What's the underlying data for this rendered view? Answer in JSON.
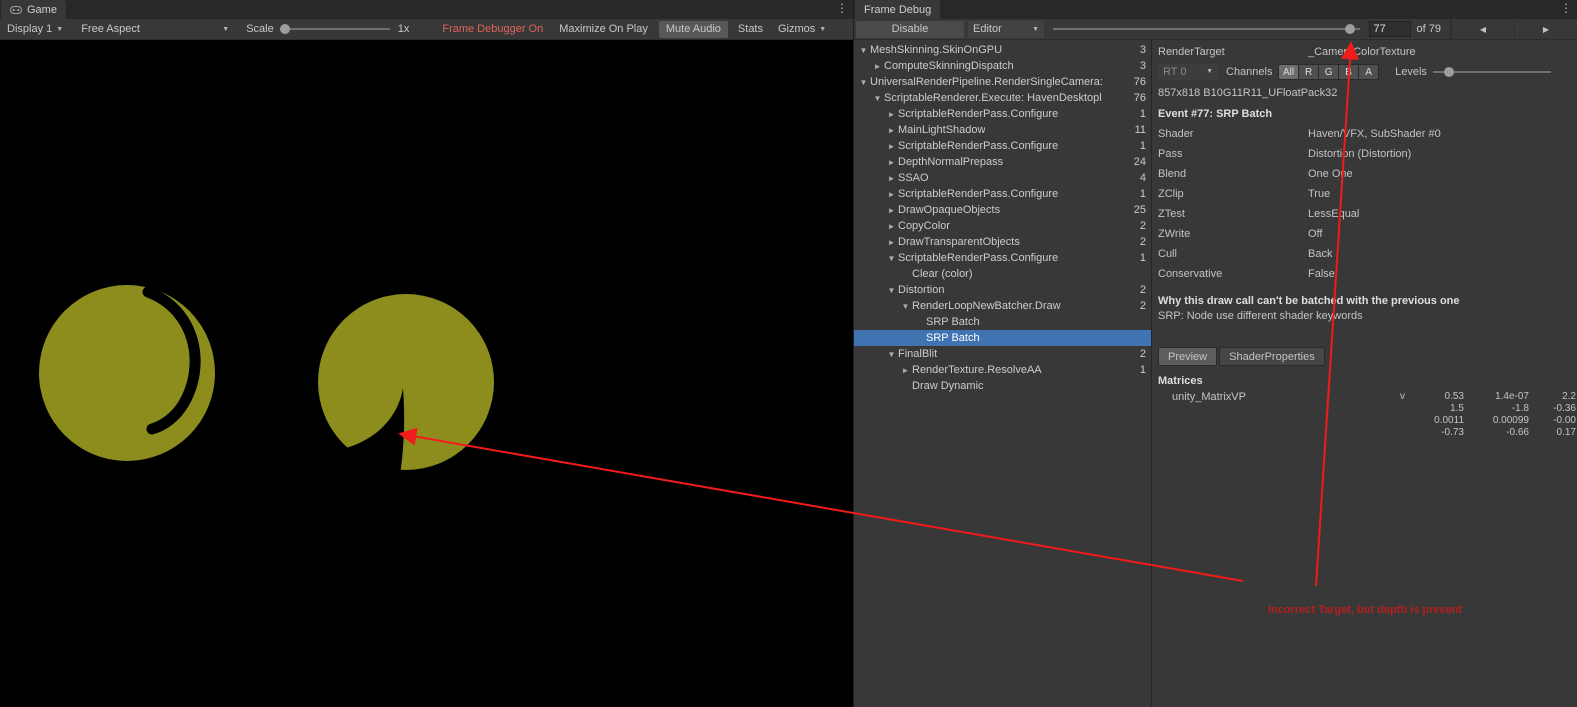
{
  "accent": {
    "selection": "#3f73b1",
    "warning_text": "#e0645a",
    "annotation_red": "#b61f1f",
    "arrow_red": "#f21b1b",
    "blob": "#8d8d1e",
    "game_background": "#000000"
  },
  "icons": {
    "caret": "▼",
    "kebab": "⋮",
    "prev": "◀",
    "next": "▶",
    "foldout_open": "▼",
    "foldout_closed": "►"
  },
  "game_panel": {
    "tab": "Game",
    "toolbar": {
      "display": "Display 1",
      "aspect": "Free Aspect",
      "scale_label": "Scale",
      "scale_value": "1x",
      "frame_debugger": "Frame Debugger On",
      "maximize": "Maximize On Play",
      "mute_audio": "Mute Audio",
      "stats": "Stats",
      "gizmos": "Gizmos"
    }
  },
  "frame_debug": {
    "tab": "Frame Debug",
    "toolbar": {
      "disable": "Disable",
      "target": "Editor",
      "current_event": "77",
      "total_label": "of 79"
    },
    "tree": [
      {
        "label": "MeshSkinning.SkinOnGPU",
        "count": "3",
        "level": 0,
        "state": "open"
      },
      {
        "label": "ComputeSkinningDispatch",
        "count": "3",
        "level": 1,
        "state": "closed"
      },
      {
        "label": "UniversalRenderPipeline.RenderSingleCamera:",
        "count": "76",
        "level": 0,
        "state": "open"
      },
      {
        "label": "ScriptableRenderer.Execute: HavenDesktopl",
        "count": "76",
        "level": 1,
        "state": "open"
      },
      {
        "label": "ScriptableRenderPass.Configure",
        "count": "1",
        "level": 2,
        "state": "closed"
      },
      {
        "label": "MainLightShadow",
        "count": "11",
        "level": 2,
        "state": "closed"
      },
      {
        "label": "ScriptableRenderPass.Configure",
        "count": "1",
        "level": 2,
        "state": "closed"
      },
      {
        "label": "DepthNormalPrepass",
        "count": "24",
        "level": 2,
        "state": "closed"
      },
      {
        "label": "SSAO",
        "count": "4",
        "level": 2,
        "state": "closed"
      },
      {
        "label": "ScriptableRenderPass.Configure",
        "count": "1",
        "level": 2,
        "state": "closed"
      },
      {
        "label": "DrawOpaqueObjects",
        "count": "25",
        "level": 2,
        "state": "closed"
      },
      {
        "label": "CopyColor",
        "count": "2",
        "level": 2,
        "state": "closed"
      },
      {
        "label": "DrawTransparentObjects",
        "count": "2",
        "level": 2,
        "state": "closed"
      },
      {
        "label": "ScriptableRenderPass.Configure",
        "count": "1",
        "level": 2,
        "state": "open"
      },
      {
        "label": "Clear (color)",
        "count": "",
        "level": 3,
        "state": "none"
      },
      {
        "label": "Distortion",
        "count": "2",
        "level": 2,
        "state": "open"
      },
      {
        "label": "RenderLoopNewBatcher.Draw",
        "count": "2",
        "level": 3,
        "state": "open"
      },
      {
        "label": "SRP Batch",
        "count": "",
        "level": 4,
        "state": "none"
      },
      {
        "label": "SRP Batch",
        "count": "",
        "level": 4,
        "state": "none",
        "selected": true
      },
      {
        "label": "FinalBlit",
        "count": "2",
        "level": 2,
        "state": "open"
      },
      {
        "label": "RenderTexture.ResolveAA",
        "count": "1",
        "level": 3,
        "state": "closed"
      },
      {
        "label": "Draw Dynamic",
        "count": "",
        "level": 3,
        "state": "none"
      }
    ],
    "detail": {
      "render_target_label": "RenderTarget",
      "render_target_value": "_CameraColorTexture",
      "rt_index": "RT 0",
      "channels_label": "Channels",
      "channels": [
        "All",
        "R",
        "G",
        "B",
        "A"
      ],
      "channels_selected": "All",
      "levels_label": "Levels",
      "texture_info": "857x818 B10G11R11_UFloatPack32",
      "event_title": "Event #77: SRP Batch",
      "properties": [
        {
          "label": "Shader",
          "value": "Haven/VFX, SubShader #0"
        },
        {
          "label": "Pass",
          "value": "Distortion (Distortion)"
        },
        {
          "label": "Blend",
          "value": "One One"
        },
        {
          "label": "ZClip",
          "value": "True"
        },
        {
          "label": "ZTest",
          "value": "LessEqual"
        },
        {
          "label": "ZWrite",
          "value": "Off"
        },
        {
          "label": "Cull",
          "value": "Back"
        },
        {
          "label": "Conservative",
          "value": "False"
        }
      ],
      "batch_title": "Why this draw call can't be batched with the previous one",
      "batch_reason": "SRP: Node use different shader keywords",
      "tabs": {
        "preview": "Preview",
        "shader_properties": "ShaderProperties"
      },
      "matrices_title": "Matrices",
      "matrix_name": "unity_MatrixVP",
      "matrix_rows": [
        [
          "v",
          "0.53",
          "1.4e-07",
          "2.2"
        ],
        [
          "",
          "1.5",
          "-1.8",
          "-0.36"
        ],
        [
          "",
          "0.0011",
          "0.00099",
          "-0.00"
        ],
        [
          "",
          "-0.73",
          "-0.66",
          "0.17"
        ]
      ]
    }
  },
  "annotation": {
    "text": "Incorrect Target, but depth is present"
  }
}
